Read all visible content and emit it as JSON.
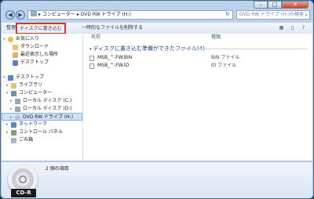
{
  "window": {
    "controls": {
      "minimize": "–",
      "maximize": "□",
      "close": "✕"
    }
  },
  "address_bar": {
    "back": "◀",
    "forward": "▶",
    "path": "▸ コンピューター ▸ DVD RW ドライブ (H:)",
    "refresh": "↻"
  },
  "search": {
    "placeholder": "DVD RW ドライブ (H:)の検索",
    "icon": "search-icon"
  },
  "toolbar": {
    "organize_label": "整理 ▾",
    "burn_label": "ディスクに書き込む",
    "delete_temp_label": "一時的なファイルを削除する",
    "view_icon": "▦",
    "pane_icon": "▯",
    "help_icon": "?"
  },
  "sidebar": {
    "items": [
      {
        "label": "お気に入り",
        "icon": "star-icon",
        "chev": "▾"
      },
      {
        "label": "ダウンロード",
        "icon": "download-folder-icon"
      },
      {
        "label": "最近表示した場所",
        "icon": "recent-places-icon"
      },
      {
        "label": "デスクトップ",
        "icon": "desktop-icon"
      },
      {
        "label": "デスクトップ",
        "icon": "desktop-icon",
        "chev": "▾"
      },
      {
        "label": "ライブラリ",
        "icon": "library-icon",
        "chev": "▸"
      },
      {
        "label": "コンピューター",
        "icon": "computer-icon",
        "chev": "▾"
      },
      {
        "label": "ローカル ディスク (C:)",
        "icon": "hard-drive-icon",
        "chev": "▸"
      },
      {
        "label": "ローカル ディスク (D:)",
        "icon": "hard-drive-icon",
        "chev": "▸"
      },
      {
        "label": "DVD RW ドライブ (H:)",
        "icon": "dvd-drive-icon",
        "chev": "▸"
      },
      {
        "label": "ネットワーク",
        "icon": "network-icon",
        "chev": "▸"
      },
      {
        "label": "コントロール パネル",
        "icon": "control-panel-icon",
        "chev": "▸"
      },
      {
        "label": "ごみ箱",
        "icon": "recycle-bin-icon"
      }
    ]
  },
  "content": {
    "columns": {
      "name": "名前",
      "type": "種類"
    },
    "group": {
      "arrow": "▾",
      "label": "ディスクに書き込む準備ができたファイル(4)"
    },
    "files": [
      {
        "name": "MSB_^-FW.BIN",
        "type": "BIN ファイル"
      },
      {
        "name": "MSB_^-FW.ID",
        "type": "ID ファイル"
      }
    ]
  },
  "details": {
    "item_count": "2 個の項目",
    "disc_label": "CD-R"
  },
  "colors": {
    "accent": "#e0321c",
    "group_text": "#1e3e8a",
    "selection": "#cde3f8"
  }
}
